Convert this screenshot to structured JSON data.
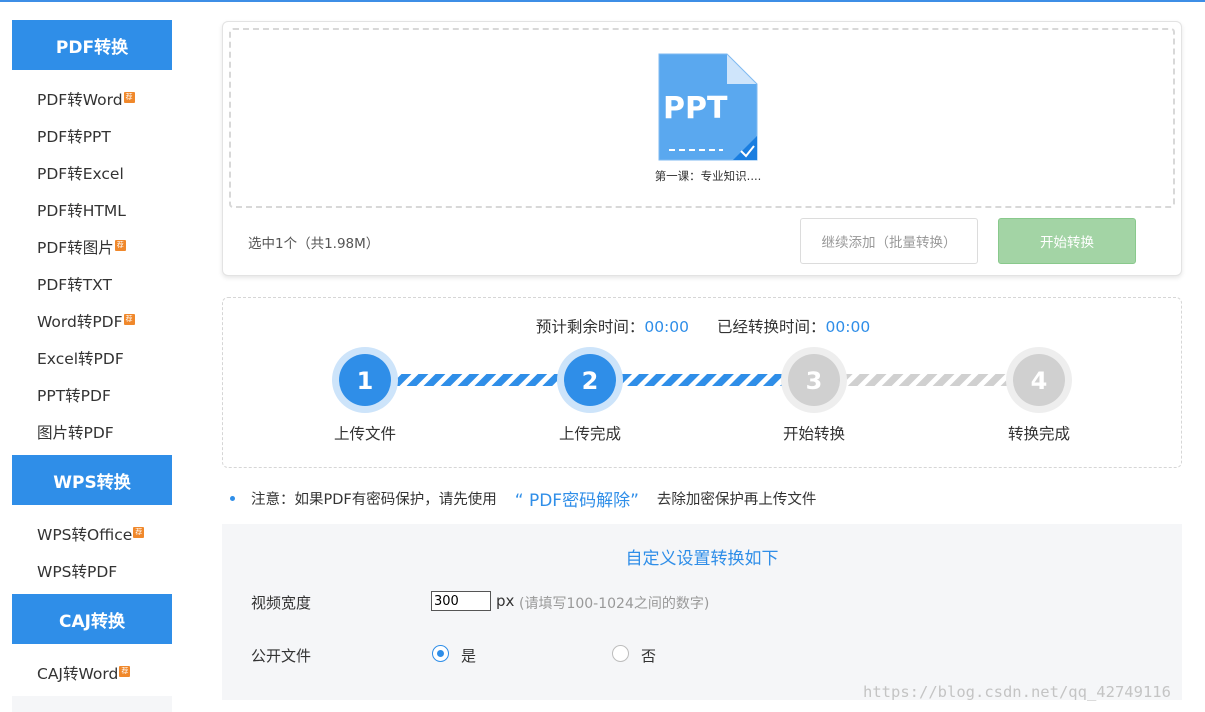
{
  "sidebar": {
    "groups": [
      {
        "title": "PDF转换",
        "items": [
          {
            "label": "PDF转Word",
            "vip": true
          },
          {
            "label": "PDF转PPT",
            "vip": false
          },
          {
            "label": "PDF转Excel",
            "vip": false
          },
          {
            "label": "PDF转HTML",
            "vip": false
          },
          {
            "label": "PDF转图片",
            "vip": true
          },
          {
            "label": "PDF转TXT",
            "vip": false
          },
          {
            "label": "Word转PDF",
            "vip": true
          },
          {
            "label": "Excel转PDF",
            "vip": false
          },
          {
            "label": "PPT转PDF",
            "vip": false
          },
          {
            "label": "图片转PDF",
            "vip": false
          }
        ]
      },
      {
        "title": "WPS转换",
        "items": [
          {
            "label": "WPS转Office",
            "vip": true
          },
          {
            "label": "WPS转PDF",
            "vip": false
          }
        ]
      },
      {
        "title": "CAJ转换",
        "items": [
          {
            "label": "CAJ转Word",
            "vip": true
          }
        ]
      }
    ],
    "vip_badge": "荐"
  },
  "upload": {
    "file_type_label": "PPT",
    "file_name": "第一课：专业知识....",
    "selected_info": "选中1个（共1.98M）",
    "add_button": "继续添加（批量转换）",
    "start_button": "开始转换"
  },
  "progress": {
    "remaining_label": "预计剩余时间：",
    "remaining_value": "00:00",
    "elapsed_label": "已经转换时间：",
    "elapsed_value": "00:00",
    "current_step": 2,
    "steps": [
      {
        "number": "1",
        "label": "上传文件"
      },
      {
        "number": "2",
        "label": "上传完成"
      },
      {
        "number": "3",
        "label": "开始转换"
      },
      {
        "number": "4",
        "label": "转换完成"
      }
    ]
  },
  "notice": {
    "prefix": "注意：如果PDF有密码保护，请先使用",
    "link": "“ PDF密码解除”",
    "suffix": "去除加密保护再上传文件"
  },
  "settings": {
    "title": "自定义设置转换如下",
    "video_width_label": "视频宽度",
    "video_width_value": "300",
    "unit": "px",
    "hint": "(请填写100-1024之间的数字)",
    "public_label": "公开文件",
    "option_yes": "是",
    "option_no": "否",
    "public_selected": "yes"
  },
  "watermark": "https://blog.csdn.net/qq_42749116",
  "colors": {
    "accent": "#2f8ee8",
    "done_step": "#2f8ee8",
    "pending_step": "#d0d0d0",
    "start_button": "#a3d4a5",
    "vip_badge": "#f0882b"
  }
}
